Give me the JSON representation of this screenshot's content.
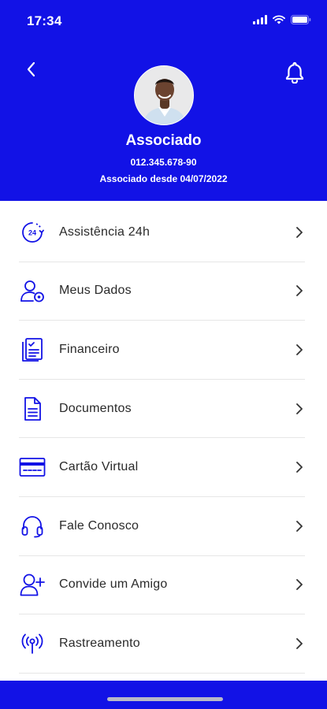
{
  "status_bar": {
    "time": "17:34"
  },
  "profile": {
    "name": "Associado",
    "document": "012.345.678-90",
    "member_since": "Associado desde 04/07/2022"
  },
  "menu": {
    "items": [
      {
        "label": "Assistência 24h",
        "icon": "assistance-24h-icon"
      },
      {
        "label": "Meus Dados",
        "icon": "user-settings-icon"
      },
      {
        "label": "Financeiro",
        "icon": "financial-document-icon"
      },
      {
        "label": "Documentos",
        "icon": "document-icon"
      },
      {
        "label": "Cartão Virtual",
        "icon": "card-icon"
      },
      {
        "label": "Fale Conosco",
        "icon": "headset-icon"
      },
      {
        "label": "Convide um Amigo",
        "icon": "add-user-icon"
      },
      {
        "label": "Rastreamento",
        "icon": "tracking-antenna-icon"
      }
    ]
  },
  "colors": {
    "brand": "#1212e6",
    "text": "#2a2a2a",
    "divider": "#e6e6e6"
  }
}
